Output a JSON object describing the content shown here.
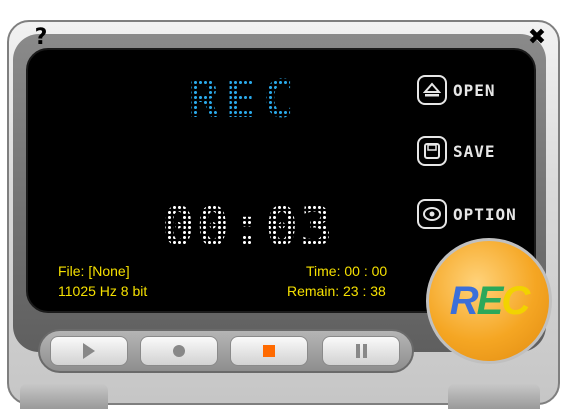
{
  "buttons": {
    "help": "?",
    "close": "✖",
    "open": "OPEN",
    "save": "SAVE",
    "option": "OPTION"
  },
  "icons": {
    "open": "eject-icon",
    "save": "floppy-disk-icon",
    "option": "disc-icon"
  },
  "display": {
    "mode": "REC",
    "elapsed": "00:03"
  },
  "info": {
    "file": "File: [None]",
    "format": "11025 Hz 8 bit",
    "time": "Time: 00 : 00",
    "remain": "Remain: 23 : 38"
  },
  "record_button": {
    "letters": [
      "R",
      "E",
      "C"
    ]
  },
  "transport": {
    "play": "play-icon",
    "record": "record-icon",
    "stop": "stop-icon",
    "pause": "pause-icon"
  },
  "colors": {
    "rec_display": "#2aa8e8",
    "time_display": "#ffffff",
    "info_text": "#f5e000",
    "record_button": "#f5a623",
    "stop_icon": "#ff6a00"
  }
}
